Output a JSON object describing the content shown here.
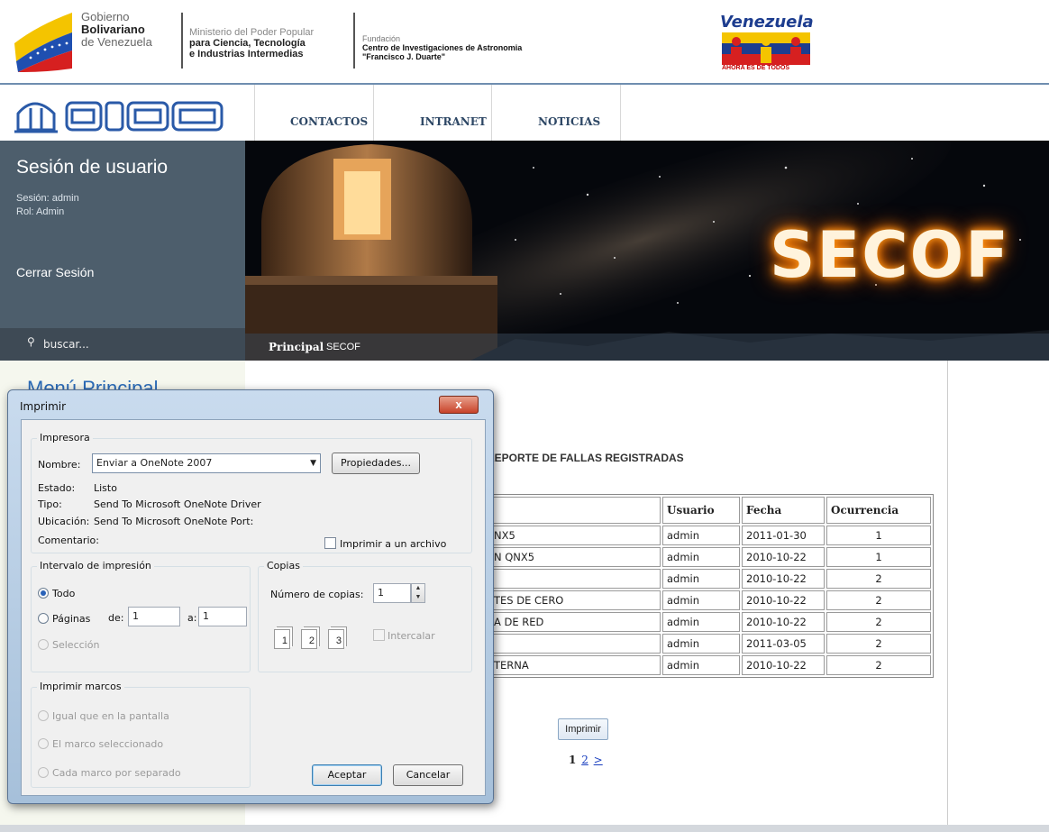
{
  "gov_banner": {
    "gobierno": [
      "Gobierno",
      "Bolivariano",
      "de Venezuela"
    ],
    "ministerio": [
      "Ministerio del Poder Popular",
      "para Ciencia, Tecnología",
      "e Industrias Intermedias"
    ],
    "fundacion": [
      "Fundación",
      "Centro de Investigaciones de Astronomia",
      "\"Francisco J. Duarte\""
    ],
    "venezuela_logo": {
      "title": "Venezuela",
      "slogan": "AHORA ES DE TODOS"
    }
  },
  "nav": {
    "logo_text": "cida",
    "items": [
      "CONTACTOS",
      "INTRANET",
      "NOTICIAS"
    ]
  },
  "session": {
    "heading": "Sesión de usuario",
    "session_line": "Sesión: admin",
    "role_line": "Rol: Admin",
    "logout": "Cerrar Sesión",
    "search_placeholder": "buscar..."
  },
  "banner": {
    "title": "SECOF"
  },
  "breadcrumb": {
    "principal": "Principal",
    "current": "SECOF"
  },
  "left_menu": {
    "heading": "Menú Principal"
  },
  "report": {
    "title": "REPORTE DE FALLAS REGISTRADAS",
    "columns": [
      "",
      "Usuario",
      "Fecha",
      "Ocurrencia"
    ],
    "rows": [
      {
        "desc": "NX5",
        "user": "admin",
        "date": "2011-01-30",
        "count": "1"
      },
      {
        "desc": "N QNX5",
        "user": "admin",
        "date": "2010-10-22",
        "count": "1"
      },
      {
        "desc": "",
        "user": "admin",
        "date": "2010-10-22",
        "count": "2"
      },
      {
        "desc": "TES DE CERO",
        "user": "admin",
        "date": "2010-10-22",
        "count": "2"
      },
      {
        "desc": "A DE RED",
        "user": "admin",
        "date": "2010-10-22",
        "count": "2"
      },
      {
        "desc": "",
        "user": "admin",
        "date": "2011-03-05",
        "count": "2"
      },
      {
        "desc": "TERNA",
        "user": "admin",
        "date": "2010-10-22",
        "count": "2"
      }
    ],
    "print_button": "Imprimir",
    "pager": {
      "current": "1",
      "next_page": "2",
      "next": ">"
    }
  },
  "dialog": {
    "title": "Imprimir",
    "close": "x",
    "printer": {
      "group": "Impresora",
      "name_label": "Nombre:",
      "name_value": "Enviar a OneNote 2007",
      "properties": "Propiedades...",
      "status_label": "Estado:",
      "status_value": "Listo",
      "type_label": "Tipo:",
      "type_value": "Send To Microsoft OneNote Driver",
      "location_label": "Ubicación:",
      "location_value": "Send To Microsoft OneNote Port:",
      "comment_label": "Comentario:",
      "print_to_file": "Imprimir a un archivo"
    },
    "range": {
      "group": "Intervalo de impresión",
      "all": "Todo",
      "pages": "Páginas",
      "from_label": "de:",
      "from_value": "1",
      "to_label": "a:",
      "to_value": "1",
      "selection": "Selección"
    },
    "copies": {
      "group": "Copias",
      "count_label": "Número de copias:",
      "count_value": "1",
      "collate": "Intercalar",
      "page_icons": [
        "1",
        "1",
        "2",
        "2",
        "3",
        "3"
      ]
    },
    "frames": {
      "group": "Imprimir marcos",
      "options": [
        "Igual que en la pantalla",
        "El marco seleccionado",
        "Cada marco por separado"
      ]
    },
    "ok": "Aceptar",
    "cancel": "Cancelar"
  },
  "colors": {
    "accent": "#2d4765",
    "panel": "#4d5e6c",
    "link": "#1a3fbf",
    "glow": "#ff7a00"
  }
}
